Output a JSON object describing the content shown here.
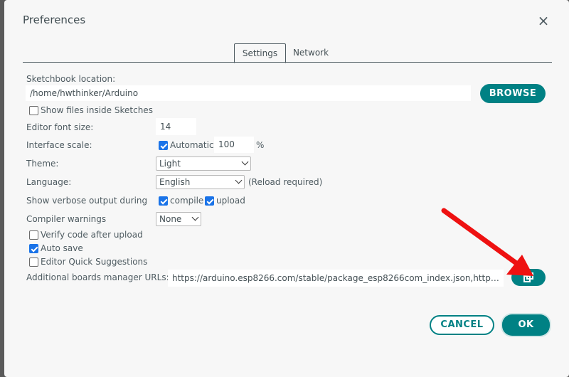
{
  "dialog": {
    "title": "Preferences",
    "close_glyph": "×"
  },
  "tabs": [
    {
      "label": "Settings",
      "active": true
    },
    {
      "label": "Network",
      "active": false
    }
  ],
  "sketchbook": {
    "label": "Sketchbook location:",
    "value": "/home/hwthinker/Arduino",
    "browse_label": "BROWSE"
  },
  "show_files": {
    "label": "Show files inside Sketches",
    "checked": false
  },
  "font_size": {
    "label": "Editor font size:",
    "value": "14"
  },
  "interface_scale": {
    "label": "Interface scale:",
    "automatic_label": "Automatic",
    "automatic_checked": true,
    "value": "100",
    "unit": "%"
  },
  "theme": {
    "label": "Theme:",
    "selected": "Light"
  },
  "language": {
    "label": "Language:",
    "selected": "English",
    "note": "(Reload required)"
  },
  "verbose": {
    "label": "Show verbose output during",
    "compile_label": "compile",
    "compile_checked": true,
    "upload_label": "upload",
    "upload_checked": true
  },
  "compiler_warnings": {
    "label": "Compiler warnings",
    "selected": "None"
  },
  "verify": {
    "label": "Verify code after upload",
    "checked": false
  },
  "auto_save": {
    "label": "Auto save",
    "checked": true
  },
  "quick_suggestions": {
    "label": "Editor Quick Suggestions",
    "checked": false
  },
  "boards_urls": {
    "label": "Additional boards manager URLs:",
    "value": "https://arduino.esp8266.com/stable/package_esp8266com_index.json,https://...",
    "open_icon": "open-external-icon"
  },
  "footer": {
    "cancel_label": "CANCEL",
    "ok_label": "OK"
  },
  "annotation": {
    "arrow_color": "#ee1111"
  },
  "colors": {
    "accent": "#008184"
  }
}
